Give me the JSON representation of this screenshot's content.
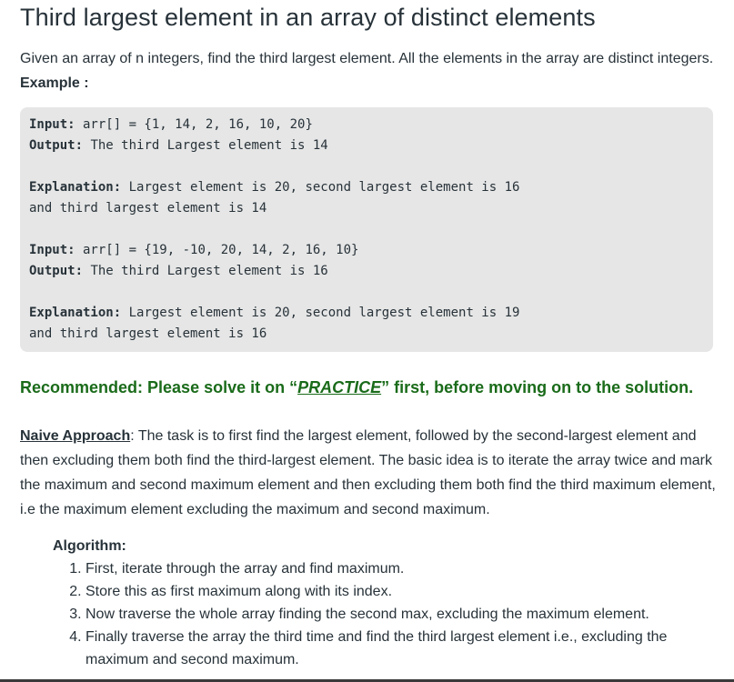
{
  "title": "Third largest element in an array of distinct elements",
  "intro": {
    "text": "Given an array of n integers, find the third largest element. All the elements in the array are distinct integers.",
    "example_label": "Example :"
  },
  "examples": [
    {
      "input_label": "Input:",
      "input_value": " arr[] = {1, 14, 2, 16, 10, 20}",
      "output_label": "Output:",
      "output_value": " The third Largest element is 14",
      "explanation_label": "Explanation:",
      "explanation_line1": " Largest element is 20, second largest element is 16",
      "explanation_line2": "and third largest element is 14"
    },
    {
      "input_label": "Input:",
      "input_value": " arr[] = {19, -10, 20, 14, 2, 16, 10}",
      "output_label": "Output:",
      "output_value": " The third Largest element is 16",
      "explanation_label": "Explanation:",
      "explanation_line1": " Largest element is 20, second largest element is 19",
      "explanation_line2": "and third largest element is 16"
    }
  ],
  "recommended": {
    "prefix": "Recommended: Please solve it on “",
    "link": "PRACTICE",
    "suffix": "” first, before moving on to the solution."
  },
  "naive": {
    "term": "Naive Approach",
    "colon": ":",
    "text": " The task is to first find the largest element, followed by the second-largest element and then excluding them both find the third-largest element. The basic idea is to iterate the array twice and mark the maximum and second maximum element and then excluding them both find the third maximum element, i.e the maximum element excluding the maximum and second maximum."
  },
  "algorithm": {
    "title": "Algorithm:",
    "steps": [
      "First, iterate through the array and find maximum.",
      "Store this as first maximum along with its index.",
      "Now traverse the whole array finding the second max, excluding the maximum element.",
      "Finally traverse the array the third time and find the third largest element i.e., excluding the maximum and second maximum."
    ]
  }
}
